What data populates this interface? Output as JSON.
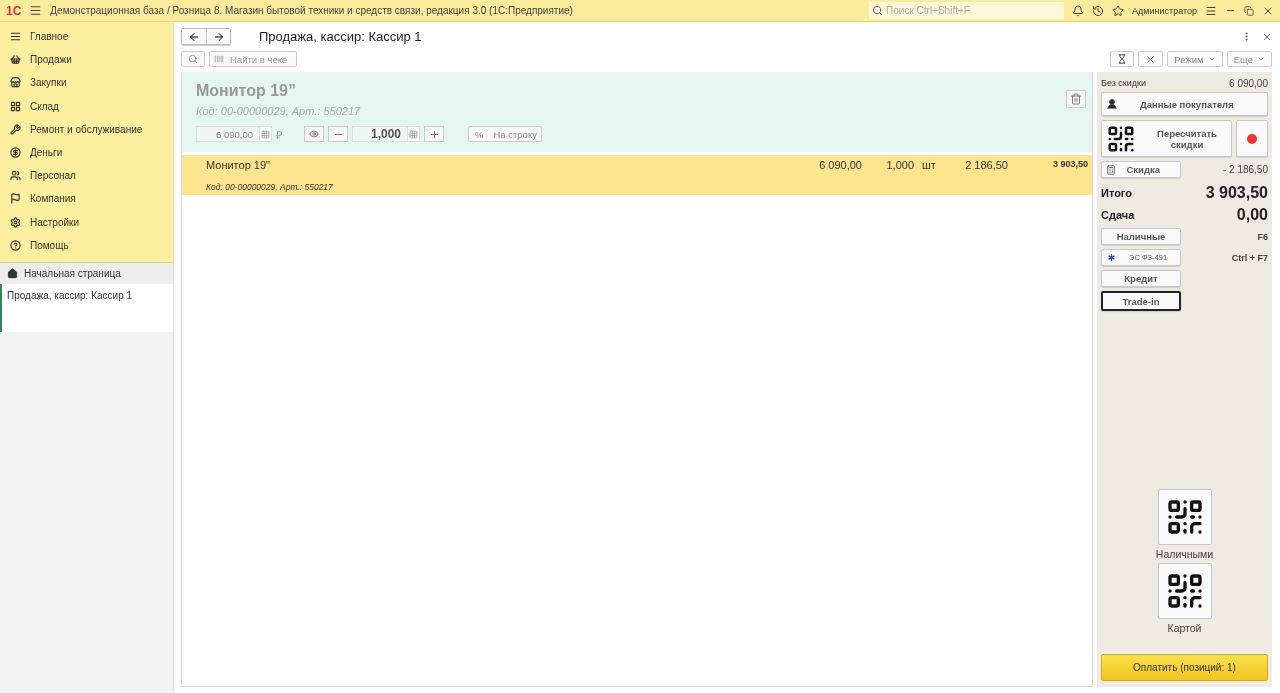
{
  "titlebar": {
    "title": "Демонстрационная база / Розница 8. Магазин бытовой техники и средств связи, редакция 3.0  (1С:Предприятие)",
    "logo": "1С",
    "search_placeholder": "Поиск Ctrl+Shift+F",
    "user": "Администратор"
  },
  "sidebar": {
    "sections": [
      {
        "label": "Главное"
      },
      {
        "label": "Продажи"
      },
      {
        "label": "Закупки"
      },
      {
        "label": "Склад"
      },
      {
        "label": "Ремонт и обслуживание"
      },
      {
        "label": "Деньги"
      },
      {
        "label": "Персонал"
      },
      {
        "label": "Компания"
      },
      {
        "label": "Настройки"
      },
      {
        "label": "Помощь"
      }
    ],
    "home": "Начальная страница",
    "open_windows": [
      {
        "label": "Продажа, кассир: Кассир 1",
        "selected": true
      }
    ]
  },
  "form": {
    "title": "Продажа, кассир: Кассир 1",
    "search_placeholder": "Найти в чеке",
    "mode_button": "Режим",
    "more_button": "Еще",
    "current_item": {
      "name": "Монитор 19”",
      "code": "Код: 00-00000029, Арт.: 550217",
      "price": "6 090,00",
      "currency": "₽",
      "quantity": "1,000",
      "percent": "%",
      "per_line": "На строку"
    },
    "rows": [
      {
        "name": "Монитор 19\"",
        "code": "Код: 00-00000029, Арт.: 550217",
        "price": "6 090,00",
        "quantity": "1,000",
        "unit": "шт",
        "discount": "2 186,50",
        "total": "3 903,50",
        "selected": true
      }
    ]
  },
  "summary": {
    "no_discount_label": "Без скидки",
    "no_discount_value": "6 090,00",
    "buyer_button": "Данные покупателя",
    "recalc_button": "Пересчитать скидки",
    "discount_button": "Скидка",
    "discount_value": "- 2 186,50",
    "total_label": "Итого",
    "total_value": "3 903,50",
    "change_label": "Сдача",
    "change_value": "0,00",
    "payments": [
      {
        "kind": "plain",
        "label": "Наличные",
        "hotkey": "F6",
        "selected": false
      },
      {
        "kind": "icon",
        "label": "ЭС ФЗ-491",
        "hotkey": "Ctrl + F7",
        "selected": false
      },
      {
        "kind": "plain",
        "label": "Кредит",
        "selected": false
      },
      {
        "kind": "plain",
        "label": "Trade-in",
        "selected": true
      }
    ],
    "qr_payments": [
      {
        "label": "Наличными"
      },
      {
        "label": "Картой"
      }
    ],
    "pay_button": "Оплатить (позиций: 1)"
  }
}
